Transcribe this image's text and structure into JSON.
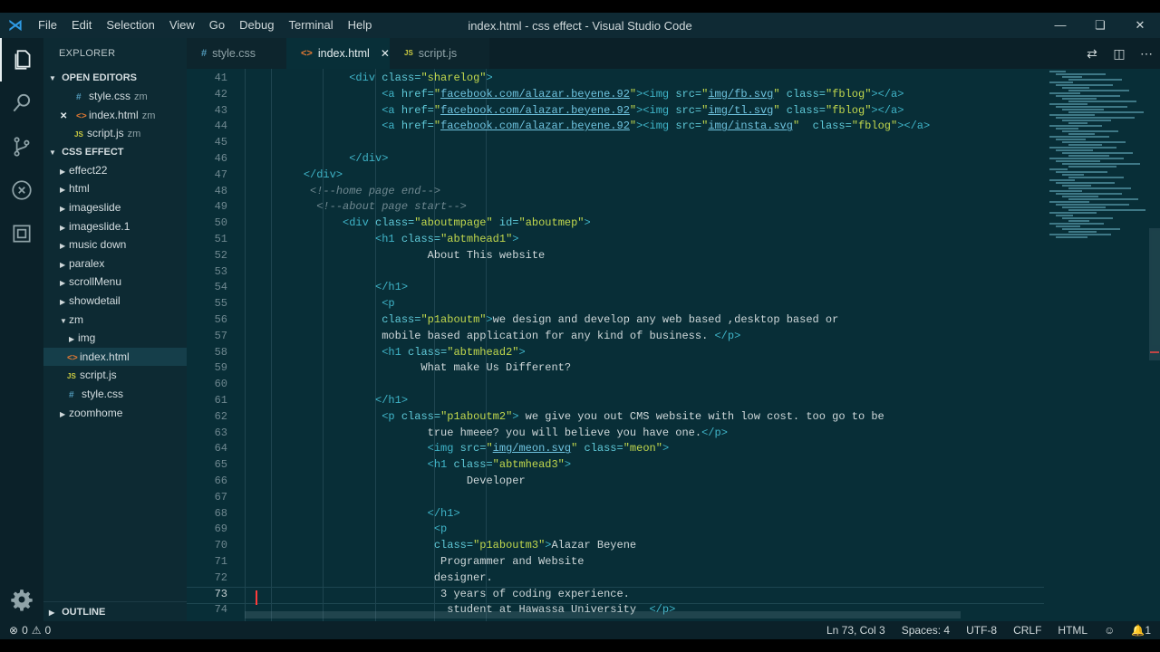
{
  "titlebar": {
    "menu": [
      "File",
      "Edit",
      "Selection",
      "View",
      "Go",
      "Debug",
      "Terminal",
      "Help"
    ],
    "title": "index.html - css effect - Visual Studio Code"
  },
  "sidebar": {
    "title": "EXPLORER",
    "open_editors_label": "OPEN EDITORS",
    "open_editors": [
      {
        "name": "style.css",
        "dir": "zm",
        "type": "css"
      },
      {
        "name": "index.html",
        "dir": "zm",
        "type": "html"
      },
      {
        "name": "script.js",
        "dir": "zm",
        "type": "js"
      }
    ],
    "project_label": "CSS EFFECT",
    "folders": [
      "effect22",
      "html",
      "imageslide",
      "imageslide.1",
      "music down",
      "paralex",
      "scrollMenu",
      "showdetail"
    ],
    "zm_folder": "zm",
    "zm_children": [
      {
        "name": "img",
        "type": "folder"
      },
      {
        "name": "index.html",
        "type": "html"
      },
      {
        "name": "script.js",
        "type": "js"
      },
      {
        "name": "style.css",
        "type": "css"
      }
    ],
    "last_folder": "zoomhome",
    "outline_label": "OUTLINE"
  },
  "tabs": [
    {
      "label": "style.css",
      "type": "css"
    },
    {
      "label": "index.html",
      "type": "html"
    },
    {
      "label": "script.js",
      "type": "js"
    }
  ],
  "editor": {
    "line_numbers": [
      "41",
      "42",
      "43",
      "44",
      "45",
      "46",
      "47",
      "48",
      "49",
      "50",
      "51",
      "52",
      "53",
      "54",
      "55",
      "56",
      "57",
      "58",
      "59",
      "60",
      "61",
      "62",
      "63",
      "64",
      "65",
      "66",
      "67",
      "68",
      "69",
      "70",
      "71",
      "72",
      "73",
      "74"
    ],
    "current_line": "73"
  },
  "status": {
    "errors": "0",
    "warnings": "0",
    "position": "Ln 73, Col 3",
    "spaces": "Spaces: 4",
    "encoding": "UTF-8",
    "eol": "CRLF",
    "language": "HTML",
    "notifications": "1"
  },
  "colors": {
    "background": "#082e37",
    "sidebar": "#0d2a33",
    "tag": "#3fb4c8",
    "string": "#c2d84d",
    "html_icon": "#e37933",
    "css_icon": "#519aba",
    "js_icon": "#cbcb41"
  }
}
